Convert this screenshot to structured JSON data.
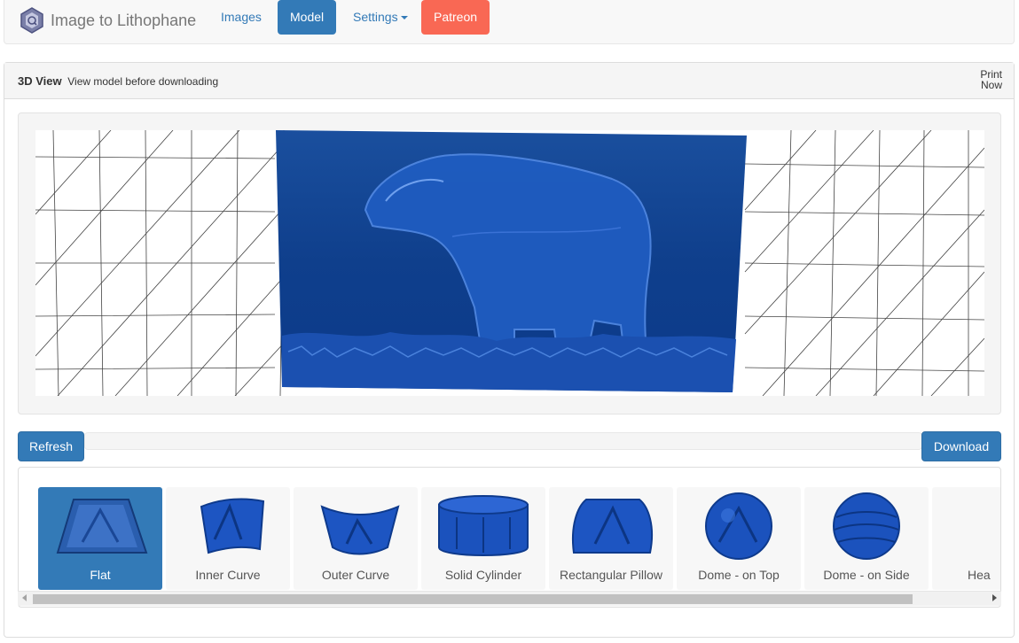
{
  "navbar": {
    "brand": "Image to Lithophane",
    "links": {
      "images": "Images",
      "model": "Model",
      "settings": "Settings",
      "patreon": "Patreon"
    }
  },
  "panel": {
    "title": "3D View",
    "subtitle": "View model before downloading",
    "print_now_line1": "Print",
    "print_now_line2": "Now"
  },
  "toolbar": {
    "refresh": "Refresh",
    "download": "Download"
  },
  "shapes": [
    {
      "label": "Flat",
      "selected": true
    },
    {
      "label": "Inner Curve",
      "selected": false
    },
    {
      "label": "Outer Curve",
      "selected": false
    },
    {
      "label": "Solid Cylinder",
      "selected": false
    },
    {
      "label": "Rectangular Pillow",
      "selected": false
    },
    {
      "label": "Dome - on Top",
      "selected": false
    },
    {
      "label": "Dome - on Side",
      "selected": false
    },
    {
      "label": "Hea",
      "selected": false
    }
  ],
  "colors": {
    "primary": "#337ab7",
    "patreon": "#f96854",
    "model_blue": "#0f4aa8"
  }
}
